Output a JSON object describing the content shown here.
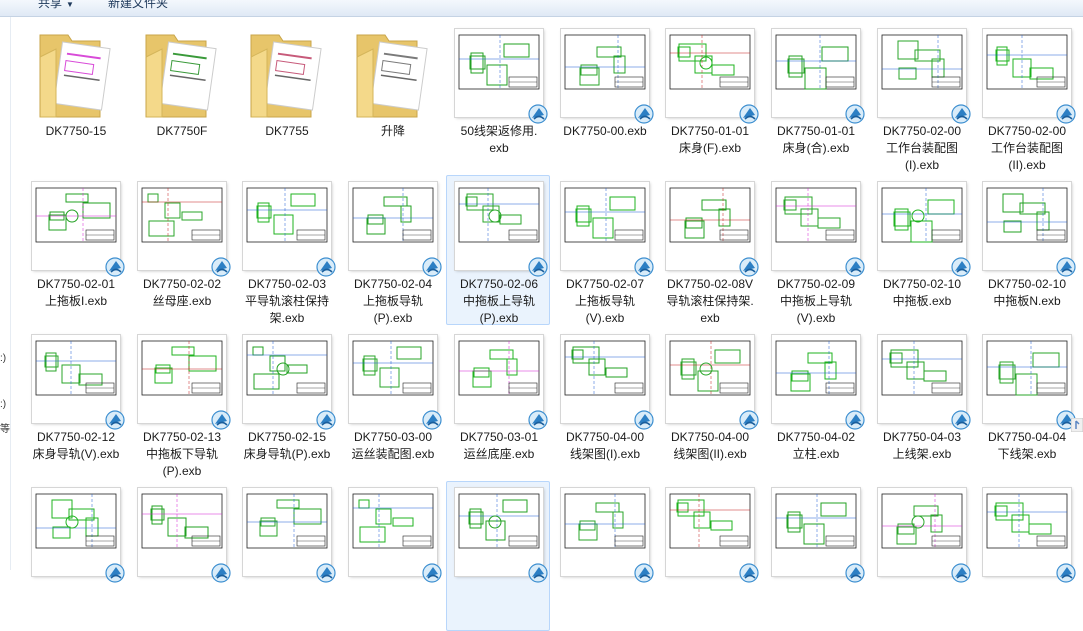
{
  "toolbar": {
    "share_label": "共享",
    "new_folder_label": "新建文件夹"
  },
  "left_edge": [
    ":)",
    ":)",
    "等"
  ],
  "files": [
    {
      "name": [
        "DK7750-15"
      ],
      "kind": "folder"
    },
    {
      "name": [
        "DK7750F"
      ],
      "kind": "folder"
    },
    {
      "name": [
        "DK7755"
      ],
      "kind": "folder"
    },
    {
      "name": [
        "升降"
      ],
      "kind": "folder"
    },
    {
      "name": [
        "50线架返修用.",
        "exb"
      ],
      "kind": "exb"
    },
    {
      "name": [
        "DK7750-00.exb"
      ],
      "kind": "exb"
    },
    {
      "name": [
        "DK7750-01-01",
        "床身(F).exb"
      ],
      "kind": "exb"
    },
    {
      "name": [
        "DK7750-01-01",
        "床身(合).exb"
      ],
      "kind": "exb"
    },
    {
      "name": [
        "DK7750-02-00",
        "工作台装配图",
        "(I).exb"
      ],
      "kind": "exb"
    },
    {
      "name": [
        "DK7750-02-00",
        "工作台装配图",
        "(II).exb"
      ],
      "kind": "exb"
    },
    {
      "name": [
        "DK7750-02-01",
        "上拖板I.exb"
      ],
      "kind": "exb"
    },
    {
      "name": [
        "DK7750-02-02",
        "丝母座.exb"
      ],
      "kind": "exb"
    },
    {
      "name": [
        "DK7750-02-03",
        "平导轨滚柱保持",
        "架.exb"
      ],
      "kind": "exb"
    },
    {
      "name": [
        "DK7750-02-04",
        "上拖板导轨",
        "(P).exb"
      ],
      "kind": "exb"
    },
    {
      "name": [
        "DK7750-02-06",
        "中拖板上导轨",
        "(P).exb"
      ],
      "kind": "exb",
      "selected": true
    },
    {
      "name": [
        "DK7750-02-07",
        "上拖板导轨",
        "(V).exb"
      ],
      "kind": "exb"
    },
    {
      "name": [
        "DK7750-02-08V",
        "导轨滚柱保持架.",
        "exb"
      ],
      "kind": "exb"
    },
    {
      "name": [
        "DK7750-02-09",
        "中拖板上导轨",
        "(V).exb"
      ],
      "kind": "exb"
    },
    {
      "name": [
        "DK7750-02-10",
        "中拖板.exb"
      ],
      "kind": "exb"
    },
    {
      "name": [
        "DK7750-02-10",
        "中拖板N.exb"
      ],
      "kind": "exb"
    },
    {
      "name": [
        "DK7750-02-12",
        "床身导轨(V).exb"
      ],
      "kind": "exb"
    },
    {
      "name": [
        "DK7750-02-13",
        "中拖板下导轨",
        "(P).exb"
      ],
      "kind": "exb"
    },
    {
      "name": [
        "DK7750-02-15",
        "床身导轨(P).exb"
      ],
      "kind": "exb"
    },
    {
      "name": [
        "DK7750-03-00",
        "运丝装配图.exb"
      ],
      "kind": "exb"
    },
    {
      "name": [
        "DK7750-03-01",
        "运丝底座.exb"
      ],
      "kind": "exb"
    },
    {
      "name": [
        "DK7750-04-00",
        "线架图(I).exb"
      ],
      "kind": "exb"
    },
    {
      "name": [
        "DK7750-04-00",
        "线架图(II).exb"
      ],
      "kind": "exb"
    },
    {
      "name": [
        "DK7750-04-02",
        "立柱.exb"
      ],
      "kind": "exb"
    },
    {
      "name": [
        "DK7750-04-03",
        "上线架.exb"
      ],
      "kind": "exb"
    },
    {
      "name": [
        "DK7750-04-04",
        "下线架.exb"
      ],
      "kind": "exb"
    },
    {
      "name": [],
      "kind": "exb"
    },
    {
      "name": [],
      "kind": "exb"
    },
    {
      "name": [],
      "kind": "exb"
    },
    {
      "name": [],
      "kind": "exb"
    },
    {
      "name": [],
      "kind": "exb",
      "selected": true
    },
    {
      "name": [],
      "kind": "exb"
    },
    {
      "name": [],
      "kind": "exb"
    },
    {
      "name": [],
      "kind": "exb"
    },
    {
      "name": [],
      "kind": "exb"
    },
    {
      "name": [],
      "kind": "exb"
    }
  ]
}
